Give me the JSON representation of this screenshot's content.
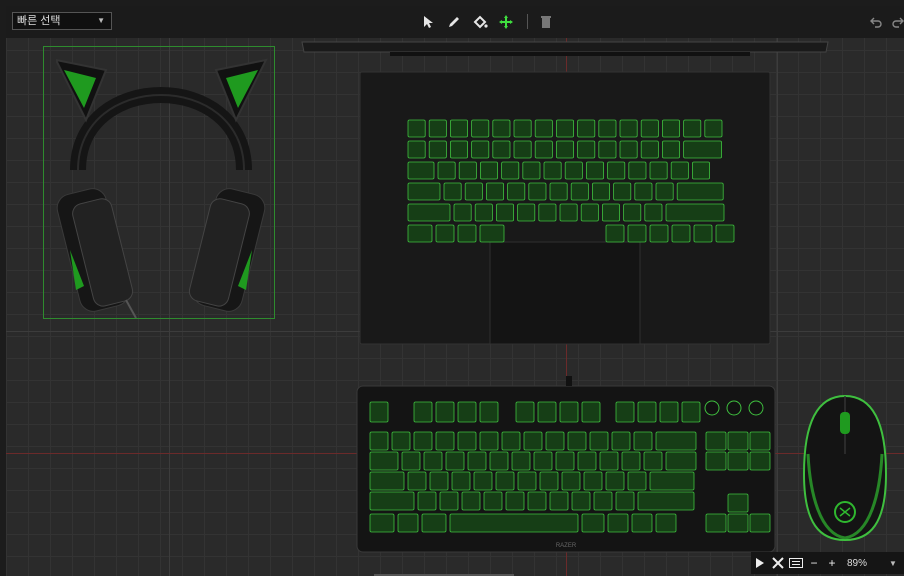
{
  "toolbar": {
    "quick_select_label": "빠른 선택",
    "tools": [
      {
        "icon": "pointer-icon"
      },
      {
        "icon": "pencil-icon"
      },
      {
        "icon": "paint-bucket-icon"
      },
      {
        "icon": "move-icon",
        "active": true
      },
      {
        "icon": "trash-icon"
      }
    ],
    "history": [
      {
        "icon": "undo-icon"
      },
      {
        "icon": "redo-icon"
      }
    ]
  },
  "devices": {
    "headset": {
      "name": "headset-kitty-ears",
      "selected": true
    },
    "laptop": {
      "name": "laptop"
    },
    "keyboard": {
      "name": "keyboard-tkl",
      "brand_text": "RAZER"
    },
    "mouse": {
      "name": "mouse"
    }
  },
  "colors": {
    "accent": "#2fd12f",
    "key_fill": "#163e16",
    "key_border": "#3fbf3f",
    "selection": "#2e8b2e",
    "guide": "#6b2a2a"
  },
  "bottombar": {
    "play_icon": "play-icon",
    "effects_icon": "effects-icon",
    "keyboard_icon": "keyboard-icon",
    "zoom_out": "−",
    "zoom_in": "+",
    "zoom_value": "89%"
  }
}
